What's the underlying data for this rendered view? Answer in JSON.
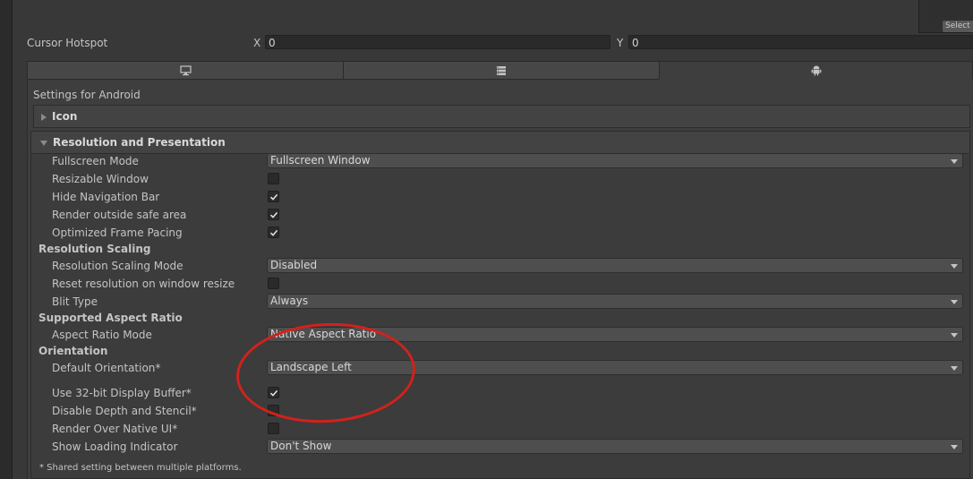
{
  "header": {
    "preview_button": "Select"
  },
  "cursor_hotspot": {
    "label": "Cursor Hotspot",
    "x_label": "X",
    "x_value": "0",
    "y_label": "Y",
    "y_value": "0"
  },
  "platform_tabs": [
    {
      "icon": "monitor-icon",
      "active": false
    },
    {
      "icon": "server-icon",
      "active": false
    },
    {
      "icon": "android-icon",
      "active": true
    }
  ],
  "settings_title": "Settings for Android",
  "sections": {
    "icon": {
      "label": "Icon",
      "expanded": false
    },
    "resolution": {
      "label": "Resolution and Presentation",
      "expanded": true
    }
  },
  "fields": {
    "fullscreen_mode": {
      "label": "Fullscreen Mode",
      "value": "Fullscreen Window"
    },
    "resizable_window": {
      "label": "Resizable Window",
      "checked": false
    },
    "hide_navigation_bar": {
      "label": "Hide Navigation Bar",
      "checked": true
    },
    "render_outside_safe_area": {
      "label": "Render outside safe area",
      "checked": true
    },
    "optimized_frame_pacing": {
      "label": "Optimized Frame Pacing",
      "checked": true
    },
    "resolution_scaling_mode": {
      "label": "Resolution Scaling Mode",
      "value": "Disabled"
    },
    "reset_resolution": {
      "label": "Reset resolution on window resize",
      "checked": false
    },
    "blit_type": {
      "label": "Blit Type",
      "value": "Always"
    },
    "aspect_ratio_mode": {
      "label": "Aspect Ratio Mode",
      "value": "Native Aspect Ratio"
    },
    "default_orientation": {
      "label": "Default Orientation*",
      "value": "Landscape Left"
    },
    "use_32bit_buffer": {
      "label": "Use 32-bit Display Buffer*",
      "checked": true
    },
    "disable_depth_stencil": {
      "label": "Disable Depth and Stencil*",
      "checked": false
    },
    "render_over_native_ui": {
      "label": "Render Over Native UI*",
      "checked": false
    },
    "show_loading_indicator": {
      "label": "Show Loading Indicator",
      "value": "Don't Show"
    }
  },
  "groups": {
    "resolution_scaling": "Resolution Scaling",
    "supported_aspect_ratio": "Supported Aspect Ratio",
    "orientation": "Orientation"
  },
  "footnote": "* Shared setting between multiple platforms.",
  "colors": {
    "background": "#383838",
    "panel": "#3e3e3e",
    "annotation": "#d2211c"
  }
}
